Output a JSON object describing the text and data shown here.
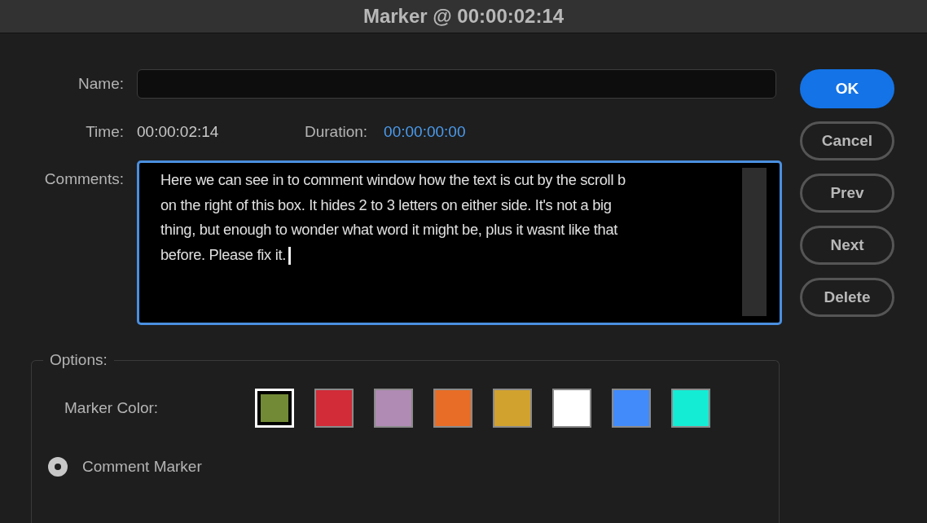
{
  "window": {
    "title": "Marker @ 00:00:02:14"
  },
  "name": {
    "label": "Name:"
  },
  "time": {
    "label": "Time:",
    "value": "00:00:02:14"
  },
  "duration": {
    "label": "Duration:",
    "value": "00:00:00:00"
  },
  "comments": {
    "label": "Comments:",
    "lines": [
      "Here we can see in to comment window how the text is cut by the scroll b",
      "on the right of this box. It hides 2 to 3 letters on either side. It's not a big",
      "thing, but enough to wonder what word it might be, plus it wasnt like that",
      "before. Please fix it."
    ]
  },
  "buttons": [
    {
      "label": "OK",
      "kind": "primary"
    },
    {
      "label": "Cancel",
      "kind": "normal"
    },
    {
      "label": "Prev",
      "kind": "normal"
    },
    {
      "label": "Next",
      "kind": "normal"
    },
    {
      "label": "Delete",
      "kind": "normal"
    }
  ],
  "options": {
    "legend": "Options:",
    "marker_color_label": "Marker Color:",
    "colors": [
      {
        "color": "#728a36",
        "selected": true
      },
      {
        "color": "#d12c38",
        "selected": false
      },
      {
        "color": "#b08bb4",
        "selected": false
      },
      {
        "color": "#e86d26",
        "selected": false
      },
      {
        "color": "#d1a22e",
        "selected": false
      },
      {
        "color": "#ffffff",
        "selected": false
      },
      {
        "color": "#418bfa",
        "selected": false
      },
      {
        "color": "#14ecd4",
        "selected": false
      }
    ],
    "radios": [
      {
        "label": "Comment Marker",
        "selected": true
      }
    ]
  }
}
